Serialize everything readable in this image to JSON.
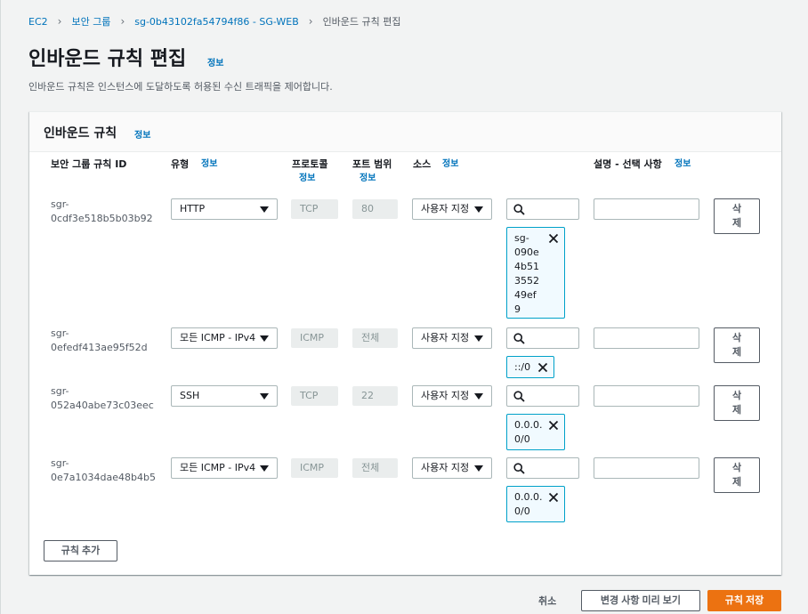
{
  "breadcrumb": {
    "items": [
      "EC2",
      "보안 그룹",
      "sg-0b43102fa54794f86 - SG-WEB"
    ],
    "current": "인바운드 규칙 편집"
  },
  "page": {
    "title": "인바운드 규칙 편집",
    "info": "정보",
    "description": "인바운드 규칙은 인스턴스에 도달하도록 허용된 수신 트래픽을 제어합니다."
  },
  "panel": {
    "title": "인바운드 규칙",
    "info": "정보",
    "columns": {
      "rule_id": "보안 그룹 규칙 ID",
      "type": "유형",
      "type_info": "정보",
      "protocol": "프로토콜",
      "protocol_info": "정보",
      "port_range": "포트 범위",
      "port_info": "정보",
      "source": "소스",
      "source_info": "정보",
      "description": "설명 - 선택 사항",
      "description_info": "정보"
    },
    "rows": [
      {
        "rule_id_line1": "sgr-",
        "rule_id_line2": "0cdf3e518b5b03b92",
        "type": "HTTP",
        "protocol": "TCP",
        "port": "80",
        "source_type": "사용자 지정",
        "token_lines": [
          "sg-",
          "090e",
          "4b51",
          "3552",
          "49ef",
          "9"
        ],
        "delete_label_1": "삭",
        "delete_label_2": "제"
      },
      {
        "rule_id_line1": "sgr-",
        "rule_id_line2": "0efedf413ae95f52d",
        "type": "모든 ICMP - IPv4",
        "protocol": "ICMP",
        "port": "전체",
        "source_type": "사용자 지정",
        "token_lines": [
          "::/0"
        ],
        "delete_label_1": "삭",
        "delete_label_2": "제"
      },
      {
        "rule_id_line1": "sgr-",
        "rule_id_line2": "052a40abe73c03eec",
        "type": "SSH",
        "protocol": "TCP",
        "port": "22",
        "source_type": "사용자 지정",
        "token_lines": [
          "0.0.0.",
          "0/0"
        ],
        "delete_label_1": "삭",
        "delete_label_2": "제"
      },
      {
        "rule_id_line1": "sgr-",
        "rule_id_line2": "0e7a1034dae48b4b5",
        "type": "모든 ICMP - IPv4",
        "protocol": "ICMP",
        "port": "전체",
        "source_type": "사용자 지정",
        "token_lines": [
          "0.0.0.",
          "0/0"
        ],
        "delete_label_1": "삭",
        "delete_label_2": "제"
      }
    ],
    "add_rule": "규칙 추가"
  },
  "footer": {
    "cancel": "취소",
    "preview": "변경 사항 미리 보기",
    "save": "규칙 저장"
  },
  "colors": {
    "link": "#0073bb",
    "primary_button": "#ec7211",
    "token_border": "#00a1c9",
    "token_bg": "#f1faff"
  }
}
